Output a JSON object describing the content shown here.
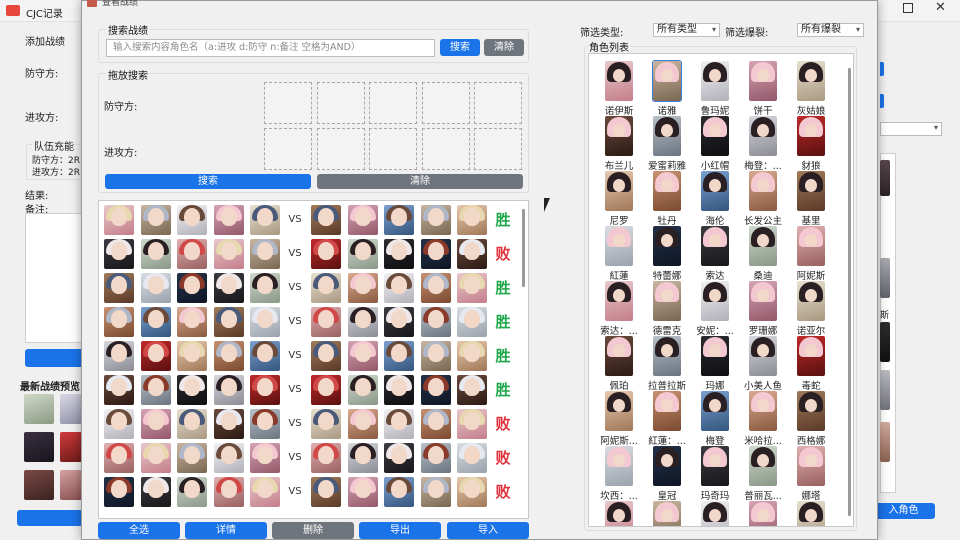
{
  "bg_window": {
    "title": "CJC记录",
    "add_record": "添加战绩",
    "defense_label": "防守方:",
    "attack_label": "进攻方:",
    "team_energy": "队伍充能",
    "def_energy": "防守方：2R",
    "att_energy": "进攻方：2R",
    "result_label": "结果:",
    "note_label": "备注:",
    "latest_preview": "最新战绩预览",
    "right_label": "斯",
    "right_button": "入角色"
  },
  "dialog": {
    "title": "查看战绩",
    "search_group": "搜索战绩",
    "search_placeholder": "输入搜索内容角色名（a:进攻 d:防守 n:备注 空格为AND）",
    "search_button": "搜索",
    "clear_button": "清除",
    "drag_group": "拖放搜索",
    "defense_label": "防守方:",
    "attack_label": "进攻方:",
    "drag_search_button": "搜索",
    "drag_clear_button": "清除",
    "vs_text": "VS",
    "records": [
      {
        "result": "胜",
        "outcome": "win"
      },
      {
        "result": "败",
        "outcome": "lose"
      },
      {
        "result": "胜",
        "outcome": "win"
      },
      {
        "result": "胜",
        "outcome": "win"
      },
      {
        "result": "胜",
        "outcome": "win"
      },
      {
        "result": "胜",
        "outcome": "win"
      },
      {
        "result": "败",
        "outcome": "lose"
      },
      {
        "result": "败",
        "outcome": "lose"
      },
      {
        "result": "败",
        "outcome": "lose"
      }
    ],
    "bottom_buttons": {
      "select_all": "全选",
      "details": "详情",
      "delete": "删除",
      "export": "导出",
      "import": "导入"
    },
    "filter_type_label": "筛选类型:",
    "filter_type_value": "所有类型",
    "filter_burst_label": "筛选爆裂:",
    "filter_burst_value": "所有爆裂",
    "char_list_title": "角色列表",
    "characters": [
      "诺伊斯",
      "诺雅",
      "鲁玛妮",
      "饼干",
      "灰姑娘",
      "布兰儿",
      "爱蜜莉雅",
      "小红帽",
      "梅登：...",
      "豺狼",
      "尼罗",
      "牡丹",
      "海伦",
      "长发公主",
      "基里",
      "紅蓮",
      "特蕾娜",
      "索达",
      "桑迪",
      "阿妮斯",
      "索达：...",
      "德雷克",
      "安妮：...",
      "罗珊娜",
      "诺亚尔",
      "佩珀",
      "拉普拉斯",
      "玛娜",
      "小美人鱼",
      "毒蛇",
      "阿妮斯...",
      "紅蓮：...",
      "梅登",
      "米哈拉...",
      "西格娜",
      "坎西：...",
      "皇冠",
      "玛奇玛",
      "普丽瓦...",
      "娜塔",
      "",
      "",
      "",
      "",
      ""
    ],
    "selected_character": "诺雅"
  },
  "colors": {
    "accent": "#1a73e8",
    "gray_button": "#6f757c",
    "win": "#1fa84a",
    "lose": "#e0323c"
  }
}
